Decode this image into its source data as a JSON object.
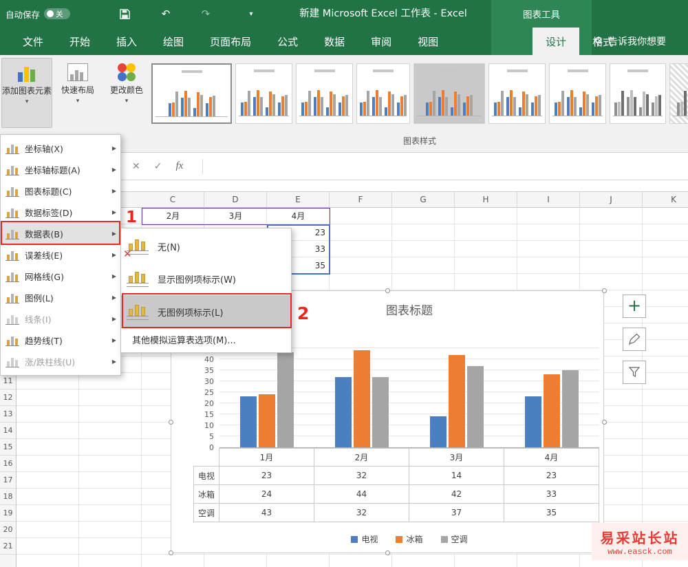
{
  "titlebar": {
    "autosave_label": "自动保存",
    "autosave_state": "关",
    "app_title": "新建 Microsoft Excel 工作表 - Excel",
    "context_group": "图表工具"
  },
  "ribbon": {
    "tabs": [
      {
        "id": "file",
        "label": "文件"
      },
      {
        "id": "home",
        "label": "开始"
      },
      {
        "id": "insert",
        "label": "插入"
      },
      {
        "id": "draw",
        "label": "绘图"
      },
      {
        "id": "page-layout",
        "label": "页面布局"
      },
      {
        "id": "formulas",
        "label": "公式"
      },
      {
        "id": "data",
        "label": "数据"
      },
      {
        "id": "review",
        "label": "审阅"
      },
      {
        "id": "view",
        "label": "视图"
      },
      {
        "id": "design",
        "label": "设计",
        "active": true,
        "contextual": true
      },
      {
        "id": "format",
        "label": "格式",
        "contextual": true
      }
    ],
    "tell_me": "告诉我你想要",
    "add_chart_element_label": "添加图表元素",
    "quick_layout_label": "快速布局",
    "change_colors_label": "更改颜色",
    "group_label": "图表样式",
    "gallery": {
      "style_count": 9,
      "selected_index": 0,
      "current_index": 4
    }
  },
  "menu": {
    "items": [
      {
        "id": "axes",
        "label": "坐标轴(X)"
      },
      {
        "id": "axis-titles",
        "label": "坐标轴标题(A)"
      },
      {
        "id": "chart-title",
        "label": "图表标题(C)"
      },
      {
        "id": "data-labels",
        "label": "数据标签(D)"
      },
      {
        "id": "data-table",
        "label": "数据表(B)",
        "open": true
      },
      {
        "id": "error-bars",
        "label": "误差线(E)"
      },
      {
        "id": "gridlines",
        "label": "网格线(G)"
      },
      {
        "id": "legend",
        "label": "图例(L)"
      },
      {
        "id": "lines",
        "label": "线条(I)",
        "disabled": true
      },
      {
        "id": "trendline",
        "label": "趋势线(T)"
      },
      {
        "id": "up-down-bars",
        "label": "涨/跌柱线(U)",
        "disabled": true
      }
    ]
  },
  "submenu": {
    "items": [
      {
        "id": "none",
        "label": "无(N)",
        "crossed": true
      },
      {
        "id": "with-legend-keys",
        "label": "显示图例项标示(W)"
      },
      {
        "id": "no-legend-keys",
        "label": "无图例项标示(L)",
        "highlighted": true
      },
      {
        "id": "more-data-table-options",
        "label": "其他模拟运算表选项(M)...",
        "text_only": true
      }
    ]
  },
  "annotations": {
    "step1": "1",
    "step2": "2"
  },
  "sheet": {
    "column_headers": [
      "C",
      "D",
      "E",
      "F",
      "G",
      "H",
      "I",
      "J",
      "K"
    ],
    "row_headers": [
      "11",
      "12",
      "13",
      "14",
      "15",
      "16",
      "17",
      "18",
      "19",
      "20",
      "21"
    ],
    "months_row": [
      "2月",
      "3月",
      "4月"
    ],
    "e_column_values": [
      "23",
      "33",
      "35"
    ]
  },
  "chart_data": {
    "type": "bar",
    "title": "图表标题",
    "categories": [
      "1月",
      "2月",
      "3月",
      "4月"
    ],
    "series": [
      {
        "name": "电视",
        "color": "#4C7FC0",
        "values": [
          23,
          32,
          14,
          23
        ]
      },
      {
        "name": "冰箱",
        "color": "#ED7D31",
        "values": [
          24,
          44,
          42,
          33
        ]
      },
      {
        "name": "空调",
        "color": "#A5A5A5",
        "values": [
          43,
          32,
          37,
          35
        ]
      }
    ],
    "ylim": [
      0,
      45
    ],
    "ytick_step": 5,
    "y_axis_labels": [
      "40",
      "35",
      "30",
      "25",
      "20",
      "15",
      "10",
      "5",
      "0"
    ],
    "gridlines": true,
    "data_table": true,
    "legend_position": "bottom"
  },
  "icons": {
    "dropdown_caret": "▾",
    "submenu_arrow": "▶",
    "close": "✕",
    "check": "✓",
    "fx": "fx",
    "plus": "+",
    "undo": "↶",
    "redo": "↷",
    "close_red": "✕"
  },
  "watermark": {
    "line1": "易采站长站",
    "line2": "www.easck.com"
  }
}
